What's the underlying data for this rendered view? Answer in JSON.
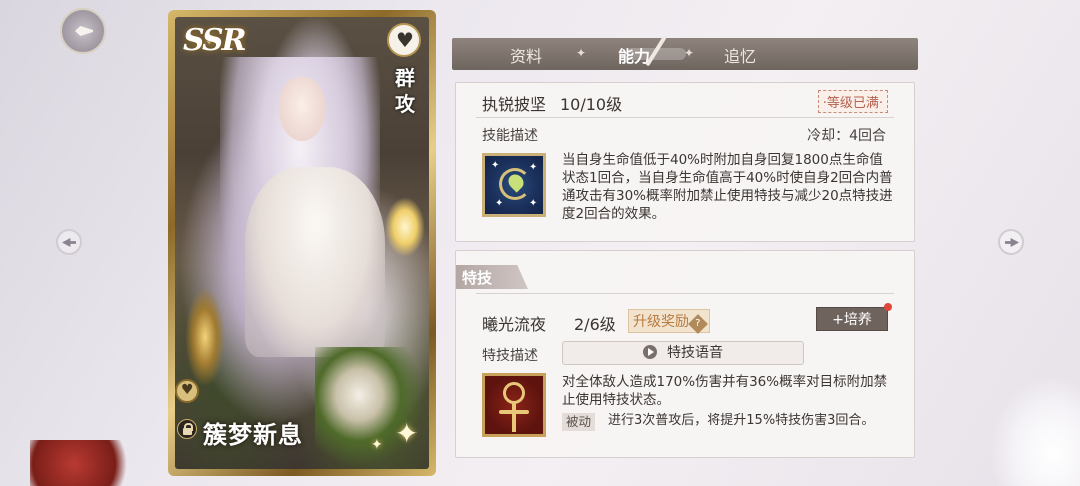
{
  "card": {
    "rarity": "SSR",
    "role": "群攻",
    "name": "簇梦新息"
  },
  "tabs": [
    "资料",
    "能力",
    "追忆"
  ],
  "active_tab": "能力",
  "skill": {
    "name": "执锐披坚",
    "level": "10/10级",
    "max_badge": "·等级已满·",
    "desc_label": "技能描述",
    "cooldown": "冷却：4回合",
    "description": "当自身生命值低于40%时附加自身回复1800点生命值状态1回合，当自身生命值高于40%时使自身2回合内普通攻击有30%概率附加禁止使用特技与减少20点特技进度2回合的效果。"
  },
  "technique": {
    "header": "特技",
    "name": "曦光流夜",
    "level": "2/6级",
    "upgrade_reward": "升级奖励",
    "cultivate_label": "培养",
    "desc_label": "特技描述",
    "voice_label": "特技语音",
    "description": "对全体敌人造成170%伤害并有36%概率对目标附加禁止使用特技状态。",
    "passive_tag": "被动",
    "passive_desc": "进行3次普攻后，将提升15%特技伤害3回合。"
  }
}
